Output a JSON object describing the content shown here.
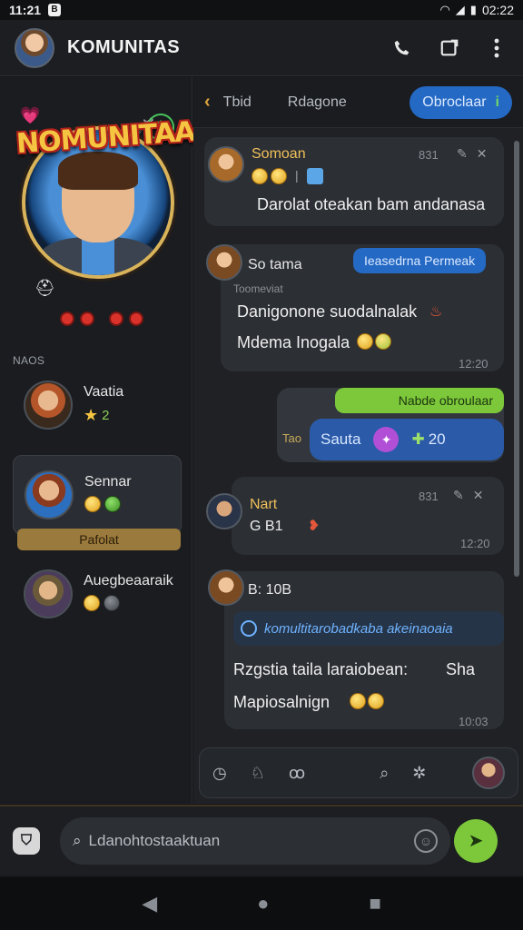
{
  "status_bar": {
    "time": "11:21",
    "notif": "B",
    "right_time": "02:22"
  },
  "app": {
    "title": "KOMUNITAS"
  },
  "sidebar": {
    "badge_text": "NOMUNITAA",
    "section_label": "NAOS",
    "members": [
      {
        "name": "Vaatia",
        "meta": "2"
      },
      {
        "name": "Sennar",
        "meta": "",
        "role": "Pafolat"
      },
      {
        "name": "Auegbeaaraik",
        "meta": ""
      }
    ]
  },
  "tabs": {
    "t1": "Tbid",
    "t2": "Rdagone",
    "primary": "Obroclaar",
    "primary_icon": "i"
  },
  "messages": [
    {
      "sender": "Somoan",
      "time": "831",
      "text": "Darolat oteakan bam andanasa"
    },
    {
      "sender": "So tama",
      "tag": "Ieasedrna Permeak",
      "sub": "Toomeviat",
      "line1": "Danigonone suodalnalak",
      "line2": "Mdema Inogala",
      "time": "12:20"
    },
    {
      "tag": "Nabde obroulaar",
      "label": "Tao",
      "bubble": "Sauta",
      "count": "20"
    },
    {
      "sender": "Nart",
      "time": "831",
      "text": "G B1",
      "time2": "12:20"
    },
    {
      "sender": "B: 10B",
      "link": "komultitarobadkaba akeinaoaia",
      "line1": "Rzgstia taila laraiobean:",
      "line1b": "Sha",
      "line2": "Mapiosalnign",
      "time": "10:03"
    }
  ],
  "composer": {
    "placeholder": "Ldanohtostaaktuan"
  },
  "colors": {
    "accent": "#2469c4",
    "send": "#7cc83a",
    "gold": "#d9b35a"
  }
}
